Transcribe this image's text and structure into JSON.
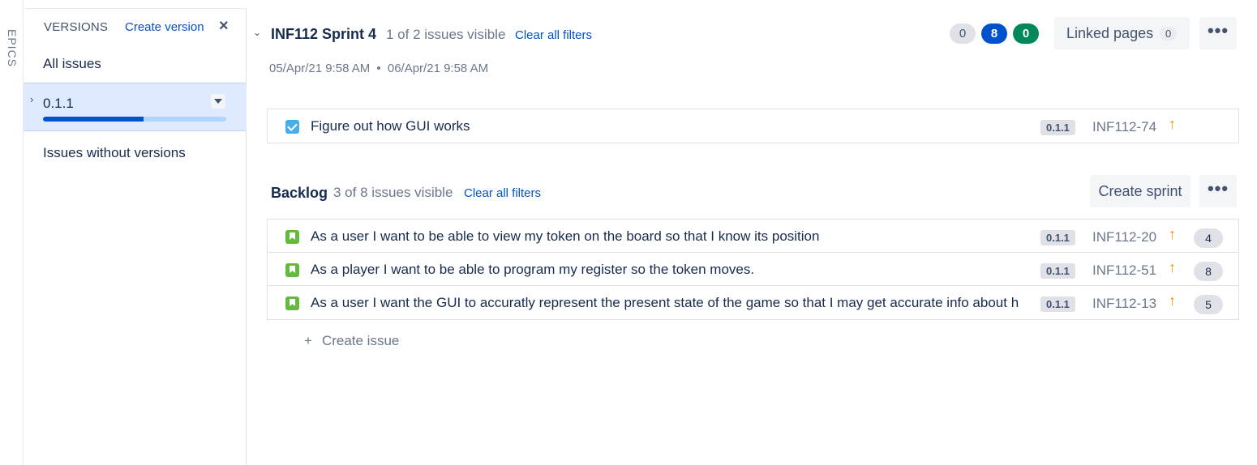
{
  "epics_tab": {
    "label": "EPICS"
  },
  "versions": {
    "header": "VERSIONS",
    "create_label": "Create version",
    "close_icon": "close-icon",
    "all_issues": "All issues",
    "selected_version": {
      "name": "0.1.1",
      "progress": 0.55
    },
    "without_versions": "Issues without versions"
  },
  "sprint": {
    "title": "INF112 Sprint 4",
    "visible": "1 of 2 issues visible",
    "clear_filters": "Clear all filters",
    "start_date": "05/Apr/21 9:58 AM",
    "date_separator": "•",
    "end_date": "06/Apr/21 9:58 AM",
    "counts": {
      "todo": "0",
      "in_progress": "8",
      "done": "0"
    },
    "linked_pages_label": "Linked pages",
    "linked_pages_count": "0",
    "more_icon": "•••",
    "issues": [
      {
        "type": "task",
        "summary": "Figure out how GUI works",
        "fix_version": "0.1.1",
        "key": "INF112-74",
        "priority": "↑",
        "estimate": ""
      }
    ]
  },
  "backlog": {
    "title": "Backlog",
    "visible": "3 of 8 issues visible",
    "clear_filters": "Clear all filters",
    "create_sprint_label": "Create sprint",
    "more_icon": "•••",
    "issues": [
      {
        "type": "story",
        "summary": "As a user I want to be able to view my token on the board so that I know its position",
        "fix_version": "0.1.1",
        "key": "INF112-20",
        "priority": "↑",
        "estimate": "4"
      },
      {
        "type": "story",
        "summary": "As a player I want to be able to program my register so the token moves.",
        "fix_version": "0.1.1",
        "key": "INF112-51",
        "priority": "↑",
        "estimate": "8"
      },
      {
        "type": "story",
        "summary": "As a user I want the GUI to accuratly represent the present state of the game so that I may get accurate info about h",
        "fix_version": "0.1.1",
        "key": "INF112-13",
        "priority": "↑",
        "estimate": "5"
      }
    ],
    "create_issue_plus": "+",
    "create_issue_label": "Create issue"
  },
  "colors": {
    "accent": "#0052cc",
    "done": "#00875a",
    "priority_high": "#ff8b00",
    "story": "#63ba3c",
    "task": "#4bade8"
  }
}
